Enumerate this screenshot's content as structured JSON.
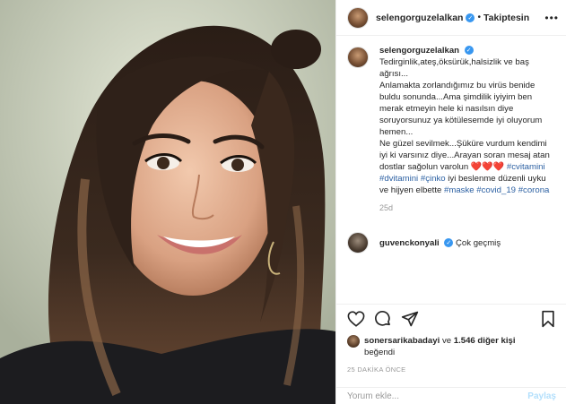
{
  "post": {
    "author": "selengorguzelalkan",
    "follow_status": "Takiptesin",
    "caption_lines": [
      "Tedirginlik,ateş,öksürük,halsizlik ve baş ağrısı...",
      "Anlamakta zorlandığımız bu virüs benide buldu sonunda...Ama şimdilik iyiyim ben merak etmeyin hele ki nasılsın diye soruyorsunuz ya kötülesemde iyi oluyorum hemen...",
      "Ne güzel sevilmek...Şüküre vurdum kendimi iyi ki varsınız diye...Arayan soran mesaj atan dostlar sağolun varolun"
    ],
    "hearts": "❤️❤️❤️",
    "hashtags": [
      "#cvitamini",
      "#dvitamini",
      "#çinko"
    ],
    "caption_tail_1": "iyi beslenme düzenli uyku ve hijyen elbette",
    "hashtags_2": [
      "#maske",
      "#covid_19",
      "#corona"
    ],
    "age": "25d"
  },
  "reply": {
    "author": "guvenckonyali",
    "text": "Çok geçmiş"
  },
  "likes": {
    "user": "sonersarikabadayi",
    "connector": "ve",
    "count": "1.546 diğer kişi",
    "suffix": "beğendi"
  },
  "timestamp": "25 DAKİKA ÖNCE",
  "comment_box": {
    "placeholder": "Yorum ekle...",
    "button": "Paylaş"
  },
  "icons": {
    "more": "more-options-icon",
    "like": "heart-icon",
    "comment": "comment-icon",
    "share": "share-icon",
    "save": "bookmark-icon",
    "verified": "verified-badge-icon"
  },
  "colors": {
    "hashtag": "#2d61a3",
    "verified": "#3897f0",
    "heart": "#e0245e",
    "muted": "#999999"
  }
}
